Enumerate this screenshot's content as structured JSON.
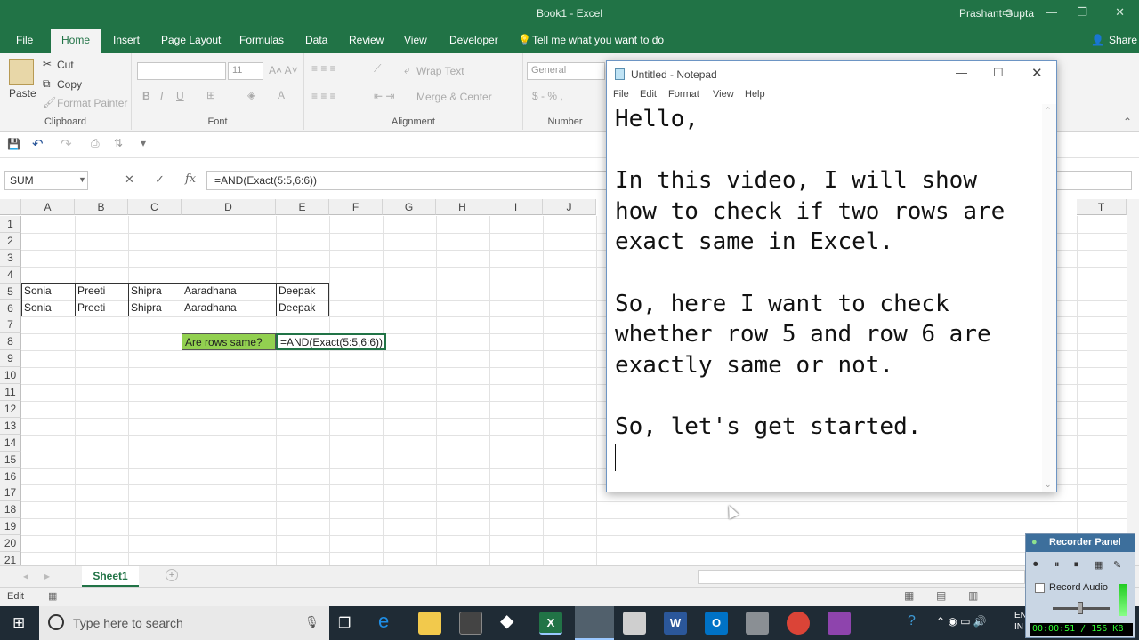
{
  "excel": {
    "title": "Book1 - Excel",
    "user": "Prashant Gupta",
    "tabs": [
      "File",
      "Home",
      "Insert",
      "Page Layout",
      "Formulas",
      "Data",
      "Review",
      "View",
      "Developer"
    ],
    "tell_me": "Tell me what you want to do",
    "share": "Share",
    "ribbon": {
      "paste": "Paste",
      "cut": "Cut",
      "copy": "Copy",
      "format_painter": "Format Painter",
      "clipboard_label": "Clipboard",
      "font_size": "11",
      "font_label": "Font",
      "wrap_text": "Wrap Text",
      "merge_center": "Merge & Center",
      "alignment_label": "Alignment",
      "number_format": "General",
      "number_label": "Number"
    },
    "name_box": "SUM",
    "formula": "=AND(Exact(5:5,6:6))",
    "columns": [
      "A",
      "B",
      "C",
      "D",
      "E",
      "F",
      "G",
      "H",
      "I",
      "J",
      "T"
    ],
    "rows": [
      "1",
      "2",
      "3",
      "4",
      "5",
      "6",
      "7",
      "8",
      "9",
      "10",
      "11",
      "12",
      "13",
      "14",
      "15",
      "16",
      "17",
      "18",
      "19",
      "20",
      "21"
    ],
    "cells": {
      "A5": "Sonia",
      "B5": "Preeti",
      "C5": "Shipra",
      "D5": "Aaradhana",
      "E5": "Deepak",
      "A6": "Sonia",
      "B6": "Preeti",
      "C6": "Shipra",
      "D6": "Aaradhana",
      "E6": "Deepak",
      "D8": "Are rows same?",
      "E8": "=AND(Exact(5:5,6:6))"
    },
    "sheet_tab": "Sheet1",
    "status": "Edit",
    "accent": "#217346",
    "highlight": "#92d050"
  },
  "notepad": {
    "title": "Untitled - Notepad",
    "menu": [
      "File",
      "Edit",
      "Format",
      "View",
      "Help"
    ],
    "text": "Hello,\n\nIn this video, I will show\nhow to check if two rows are\nexact same in Excel.\n\nSo, here I want to check\nwhether row 5 and row 6 are\nexactly same or not.\n\nSo, let's get started.\n"
  },
  "taskbar": {
    "search_placeholder": "Type here to search",
    "lang": "EN\nIN"
  },
  "recorder": {
    "title": "Recorder Panel",
    "record_audio": "Record Audio",
    "status": "00:00:51 / 156 KB"
  }
}
